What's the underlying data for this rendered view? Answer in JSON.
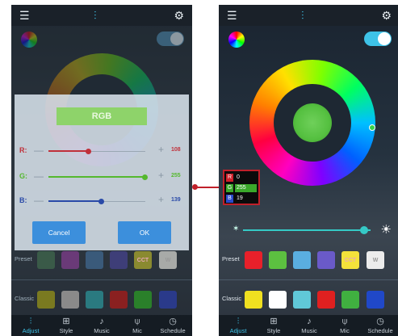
{
  "left": {
    "dialog": {
      "title": "RGB",
      "sliders": [
        {
          "label": "R:",
          "value": "108",
          "fraction": 0.42,
          "color": "#c0303a"
        },
        {
          "label": "G:",
          "value": "255",
          "fraction": 1.0,
          "color": "#55b82e"
        },
        {
          "label": "B:",
          "value": "139",
          "fraction": 0.55,
          "color": "#2a4aa8"
        }
      ],
      "cancel": "Cancel",
      "ok": "OK"
    },
    "preset_label": "Preset",
    "presets": [
      "",
      "",
      "",
      "",
      "CCT",
      "W"
    ],
    "classic_label": "Classic",
    "tabs": [
      {
        "icon": "adjust-icon",
        "label": "Adjust"
      },
      {
        "icon": "style-icon",
        "label": "Style"
      },
      {
        "icon": "music-icon",
        "label": "Music"
      },
      {
        "icon": "mic-icon",
        "label": "Mic"
      },
      {
        "icon": "schedule-icon",
        "label": "Schedule"
      }
    ]
  },
  "right": {
    "rgb_readout": [
      {
        "tag": "R",
        "value": "0",
        "tag_color": "#d0202a"
      },
      {
        "tag": "G",
        "value": "255",
        "tag_color": "#3aa82a"
      },
      {
        "tag": "B",
        "value": "19",
        "tag_color": "#2a4acc"
      }
    ],
    "brightness": 0.95,
    "preset_label": "Preset",
    "presets": [
      {
        "color": "#e8202a",
        "text": ""
      },
      {
        "color": "#5cc040",
        "text": ""
      },
      {
        "color": "#5aaee0",
        "text": ""
      },
      {
        "color": "#6a5ac8",
        "text": ""
      },
      {
        "color": "#f4e23a",
        "text": "CCT"
      },
      {
        "color": "#ececec",
        "text": "W"
      }
    ],
    "classic_label": "Classic",
    "classics": [
      "#f0e020",
      "#ffffff",
      "#60c8d8",
      "#e02020",
      "#40b040",
      "#2048c8"
    ],
    "tabs": [
      {
        "icon": "adjust-icon",
        "label": "Adjust"
      },
      {
        "icon": "style-icon",
        "label": "Style"
      },
      {
        "icon": "music-icon",
        "label": "Music"
      },
      {
        "icon": "mic-icon",
        "label": "Mic"
      },
      {
        "icon": "schedule-icon",
        "label": "Schedule"
      }
    ]
  },
  "left_preset_colors": [
    "#3a5a48",
    "#6a3a78",
    "#3a5a7a",
    "#3e3e78",
    "#8a8a30",
    "#a8aaa8"
  ],
  "left_classic_colors": [
    "#7a7a20",
    "#8a8a8a",
    "#2a7a80",
    "#8a2020",
    "#2a802a",
    "#2a3a8a"
  ],
  "accent": "#3ec3e8"
}
